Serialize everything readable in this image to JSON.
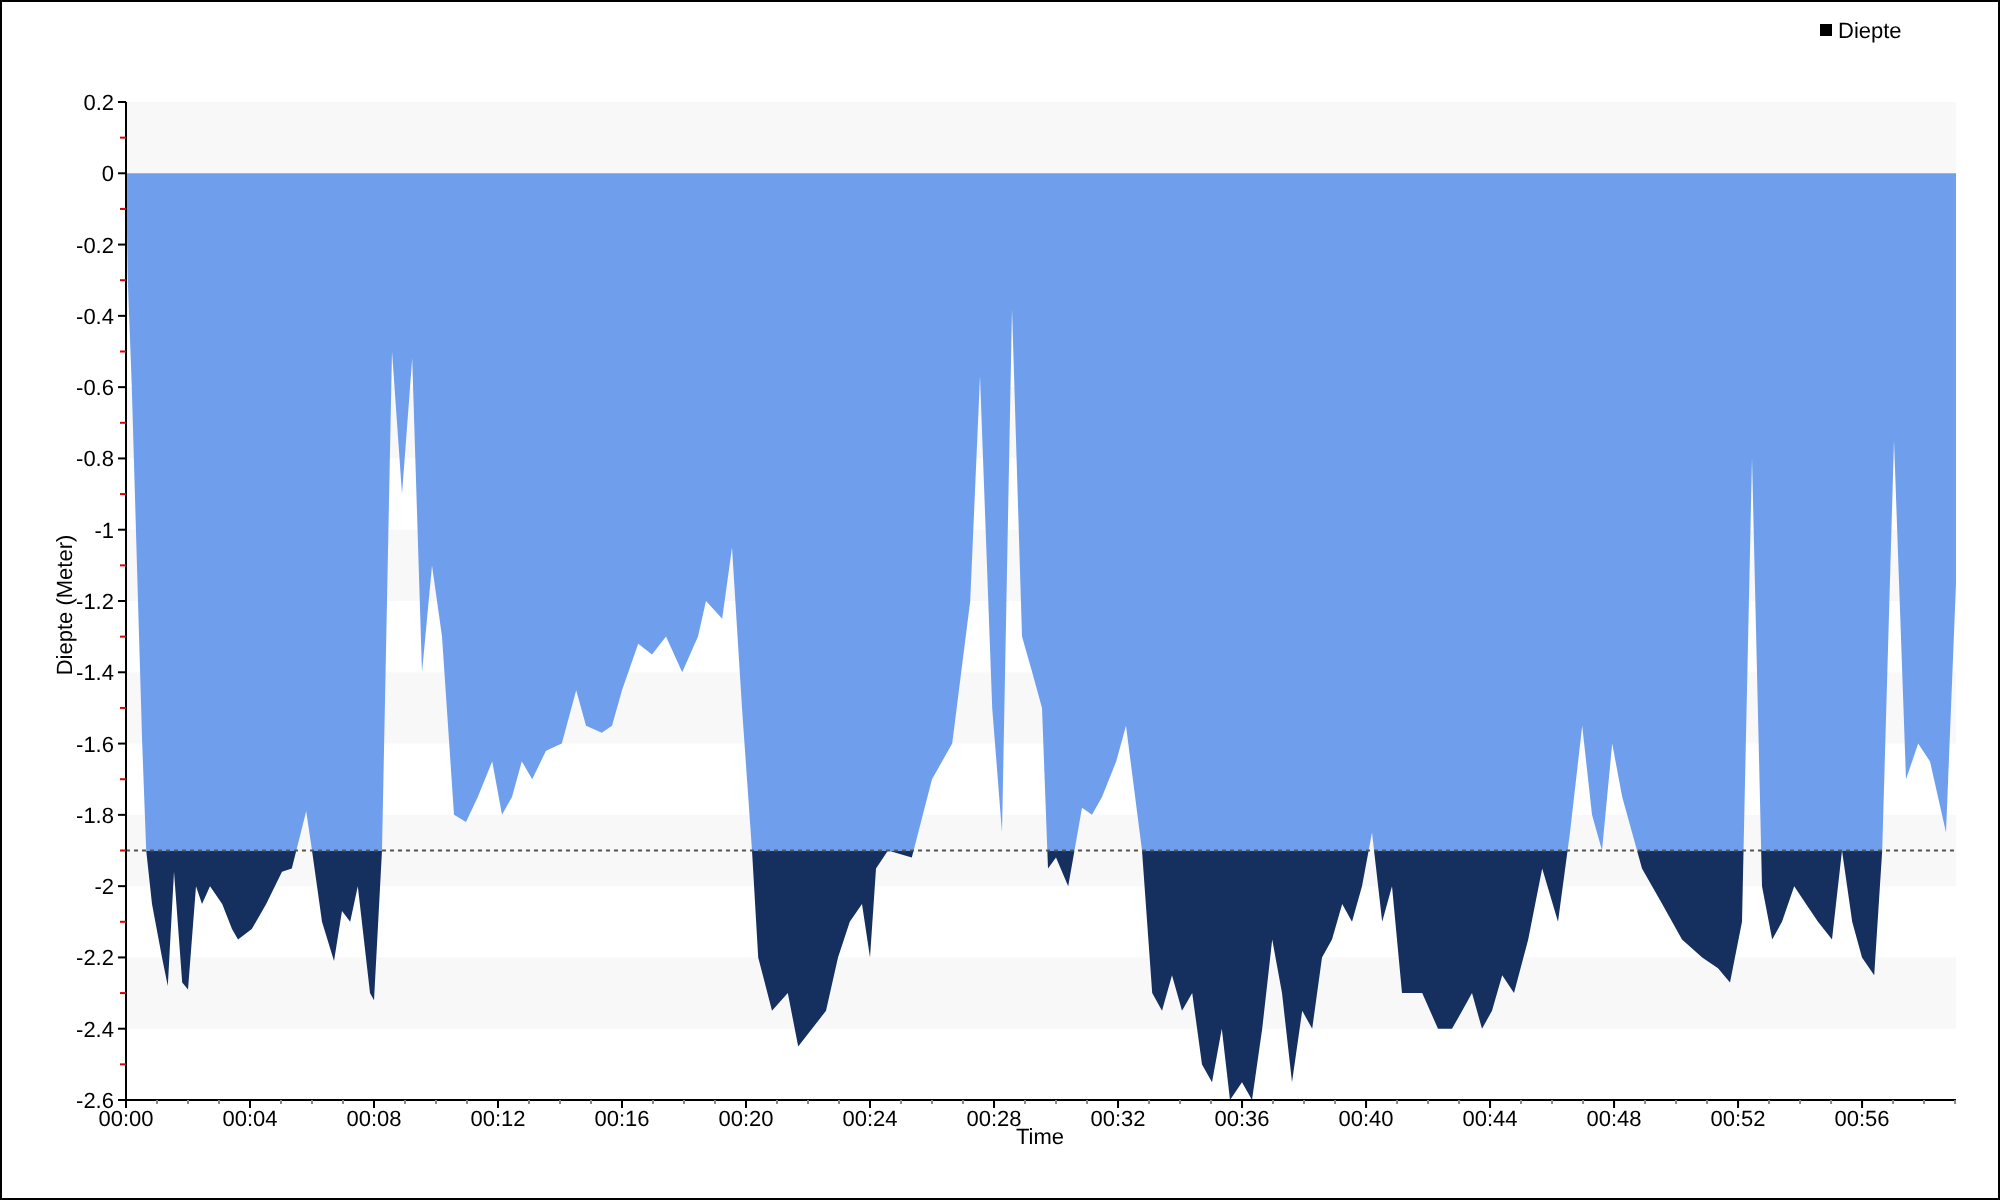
{
  "chart": {
    "chart_data": {
      "type": "area",
      "xlabel": "Time",
      "ylabel": "Diepte (Meter)",
      "x": [
        0,
        0.06,
        0.19,
        0.39,
        0.52,
        0.65,
        0.84,
        1.16,
        1.35,
        1.55,
        1.81,
        2.0,
        2.26,
        2.45,
        2.71,
        3.1,
        3.42,
        3.61,
        4.06,
        4.52,
        5.03,
        5.35,
        5.81,
        6.0,
        6.32,
        6.71,
        6.97,
        7.23,
        7.48,
        7.87,
        8.0,
        8.26,
        8.58,
        8.9,
        9.23,
        9.55,
        9.87,
        10.19,
        10.58,
        10.97,
        11.35,
        11.81,
        12.13,
        12.45,
        12.77,
        13.1,
        13.55,
        14.06,
        14.52,
        14.84,
        15.35,
        15.68,
        16.0,
        16.52,
        16.97,
        17.42,
        17.94,
        18.45,
        18.71,
        19.23,
        19.55,
        19.87,
        20.19,
        20.39,
        20.84,
        21.35,
        21.68,
        22.13,
        22.58,
        22.97,
        23.35,
        23.74,
        24.0,
        24.19,
        24.58,
        25.35,
        26.0,
        26.65,
        27.23,
        27.55,
        27.94,
        28.26,
        28.58,
        28.9,
        29.23,
        29.55,
        29.74,
        30.0,
        30.39,
        30.84,
        31.16,
        31.48,
        31.94,
        32.26,
        32.77,
        33.1,
        33.42,
        33.74,
        34.06,
        34.39,
        34.71,
        35.03,
        35.35,
        35.61,
        36.0,
        36.32,
        36.65,
        36.97,
        37.29,
        37.61,
        37.94,
        38.26,
        38.58,
        38.9,
        39.23,
        39.55,
        39.87,
        40.19,
        40.52,
        40.84,
        41.16,
        41.81,
        42.32,
        42.77,
        43.1,
        43.42,
        43.74,
        44.06,
        44.39,
        44.77,
        45.23,
        45.68,
        46.19,
        46.58,
        46.97,
        47.29,
        47.61,
        47.94,
        48.26,
        48.9,
        49.55,
        50.19,
        50.84,
        51.35,
        51.74,
        52.13,
        52.45,
        52.77,
        53.1,
        53.42,
        53.81,
        54.19,
        54.58,
        55.03,
        55.35,
        55.68,
        56.0,
        56.39,
        56.65,
        57.03,
        57.42,
        57.81,
        58.19,
        58.58,
        58.71,
        59.03
      ],
      "series": [
        {
          "name": "Diepte",
          "color": "#6f9fec",
          "values": [
            0,
            -0.3,
            -0.6,
            -1.2,
            -1.6,
            -1.9,
            -2.05,
            -2.2,
            -2.28,
            -1.96,
            -2.27,
            -2.29,
            -2.0,
            -2.05,
            -2.0,
            -2.05,
            -2.12,
            -2.15,
            -2.12,
            -2.05,
            -1.96,
            -1.95,
            -1.79,
            -1.9,
            -2.1,
            -2.21,
            -2.07,
            -2.1,
            -2.0,
            -2.3,
            -2.32,
            -1.9,
            -0.5,
            -0.9,
            -0.52,
            -1.4,
            -1.1,
            -1.3,
            -1.8,
            -1.82,
            -1.75,
            -1.65,
            -1.8,
            -1.75,
            -1.65,
            -1.7,
            -1.62,
            -1.6,
            -1.45,
            -1.55,
            -1.57,
            -1.55,
            -1.45,
            -1.32,
            -1.35,
            -1.3,
            -1.4,
            -1.3,
            -1.2,
            -1.25,
            -1.05,
            -1.5,
            -1.9,
            -2.2,
            -2.35,
            -2.3,
            -2.45,
            -2.4,
            -2.35,
            -2.2,
            -2.1,
            -2.05,
            -2.2,
            -1.95,
            -1.9,
            -1.92,
            -1.7,
            -1.6,
            -1.2,
            -0.57,
            -1.5,
            -1.85,
            -0.38,
            -1.3,
            -1.4,
            -1.5,
            -1.95,
            -1.92,
            -2.0,
            -1.78,
            -1.8,
            -1.75,
            -1.65,
            -1.55,
            -1.9,
            -2.3,
            -2.35,
            -2.25,
            -2.35,
            -2.3,
            -2.5,
            -2.55,
            -2.4,
            -2.6,
            -2.55,
            -2.6,
            -2.4,
            -2.15,
            -2.3,
            -2.55,
            -2.35,
            -2.4,
            -2.2,
            -2.15,
            -2.05,
            -2.1,
            -2.0,
            -1.85,
            -2.1,
            -2.0,
            -2.3,
            -2.3,
            -2.4,
            -2.4,
            -2.35,
            -2.3,
            -2.4,
            -2.35,
            -2.25,
            -2.3,
            -2.15,
            -1.95,
            -2.1,
            -1.85,
            -1.55,
            -1.8,
            -1.9,
            -1.6,
            -1.75,
            -1.95,
            -2.05,
            -2.15,
            -2.2,
            -2.23,
            -2.27,
            -2.1,
            -0.8,
            -2.0,
            -2.15,
            -2.1,
            -2.0,
            -2.05,
            -2.1,
            -2.15,
            -1.9,
            -2.1,
            -2.2,
            -2.25,
            -1.9,
            -0.75,
            -1.7,
            -1.6,
            -1.65,
            -1.8,
            -1.85,
            -1.15
          ]
        }
      ],
      "xlim": [
        0,
        59.03
      ],
      "ylim": [
        -2.6,
        0.2
      ],
      "xticks": [
        {
          "value": 0,
          "label": "00:00"
        },
        {
          "value": 4,
          "label": "00:04"
        },
        {
          "value": 8,
          "label": "00:08"
        },
        {
          "value": 12,
          "label": "00:12"
        },
        {
          "value": 16,
          "label": "00:16"
        },
        {
          "value": 20,
          "label": "00:20"
        },
        {
          "value": 24,
          "label": "00:24"
        },
        {
          "value": 28,
          "label": "00:28"
        },
        {
          "value": 32,
          "label": "00:32"
        },
        {
          "value": 36,
          "label": "00:36"
        },
        {
          "value": 40,
          "label": "00:40"
        },
        {
          "value": 44,
          "label": "00:44"
        },
        {
          "value": 48,
          "label": "00:48"
        },
        {
          "value": 52,
          "label": "00:52"
        },
        {
          "value": 56,
          "label": "00:56"
        }
      ],
      "yticks": [
        0.2,
        0,
        -0.2,
        -0.4,
        -0.6,
        -0.8,
        -1,
        -1.2,
        -1.4,
        -1.6,
        -1.8,
        -2,
        -2.2,
        -2.4,
        -2.6
      ],
      "ref_lines": [
        {
          "axis": "y",
          "value": -1.9,
          "color": "#555555"
        }
      ]
    }
  }
}
